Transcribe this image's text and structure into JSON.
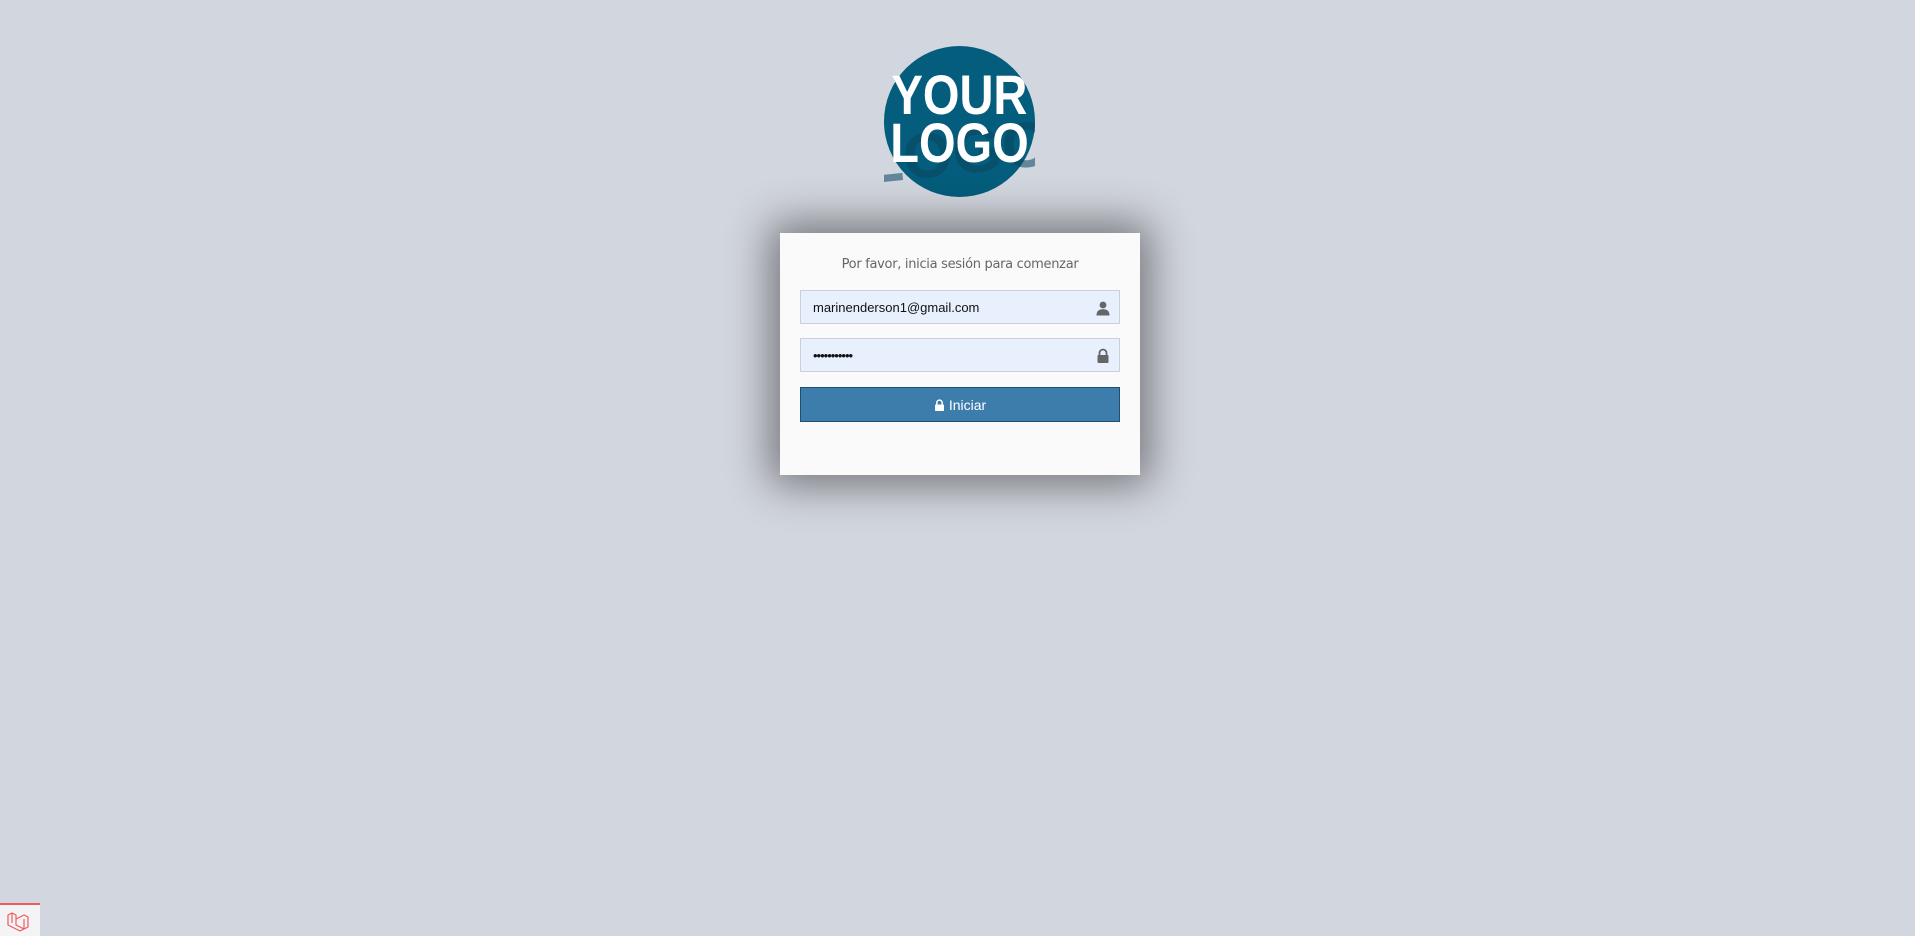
{
  "logo": {
    "line1": "YOUR",
    "line2": "LOGO",
    "color": "#045d7c"
  },
  "login": {
    "message": "Por favor, inicia sesión para comenzar",
    "email": {
      "value": "marinenderson1@gmail.com",
      "icon": "user-icon"
    },
    "password": {
      "value": "•••••••••••",
      "icon": "lock-icon"
    },
    "submit": {
      "label": "Iniciar",
      "icon": "lock-icon",
      "color": "#3c7dab"
    }
  },
  "corner_badge": {
    "icon": "laravel-icon",
    "accent": "#ef5b5b"
  }
}
